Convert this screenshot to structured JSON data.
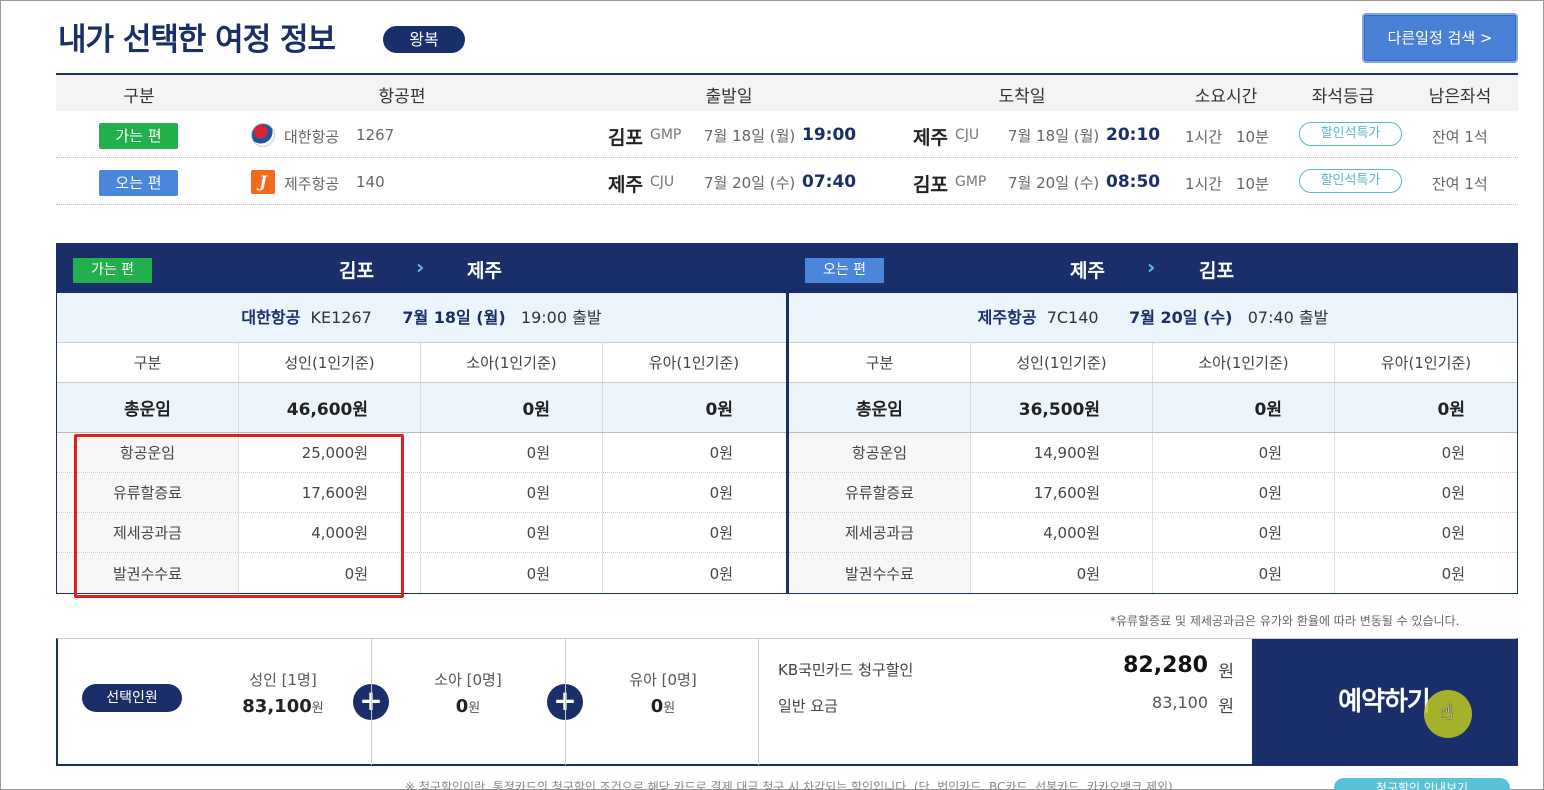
{
  "header": {
    "title": "내가 선택한 여정 정보",
    "trip_type": "왕복",
    "other_search": "다른일정 검색 >"
  },
  "summary": {
    "columns": [
      "구분",
      "항공편",
      "출발일",
      "도착일",
      "소요시간",
      "좌석등급",
      "남은좌석"
    ],
    "rows": [
      {
        "dir": "가는 편",
        "airline": "대한항공",
        "flight_no": "1267",
        "dep_city": "김포",
        "dep_code": "GMP",
        "dep_date": "7월 18일 (월)",
        "dep_time": "19:00",
        "arr_city": "제주",
        "arr_code": "CJU",
        "arr_date": "7월 18일 (월)",
        "arr_time": "20:10",
        "duration_h": "1시간",
        "duration_m": "10분",
        "seat_class": "할인석특가",
        "seats": "잔여 1석"
      },
      {
        "dir": "오는 편",
        "airline": "제주항공",
        "flight_no": "140",
        "dep_city": "제주",
        "dep_code": "CJU",
        "dep_date": "7월 20일 (수)",
        "dep_time": "07:40",
        "arr_city": "김포",
        "arr_code": "GMP",
        "arr_date": "7월 20일 (수)",
        "arr_time": "08:50",
        "duration_h": "1시간",
        "duration_m": "10분",
        "seat_class": "할인석특가",
        "seats": "잔여 1석"
      }
    ]
  },
  "panels": [
    {
      "badge": "가는 편",
      "from": "김포",
      "to": "제주",
      "airline": "대한항공",
      "flight_code": "KE1267",
      "date": "7월 18일 (월)",
      "depart": "19:00 출발",
      "headers": [
        "구분",
        "성인(1인기준)",
        "소아(1인기준)",
        "유아(1인기준)"
      ],
      "total": [
        "총운임",
        "46,600원",
        "0원",
        "0원"
      ],
      "rows": [
        [
          "항공운임",
          "25,000원",
          "0원",
          "0원"
        ],
        [
          "유류할증료",
          "17,600원",
          "0원",
          "0원"
        ],
        [
          "제세공과금",
          "4,000원",
          "0원",
          "0원"
        ],
        [
          "발권수수료",
          "0원",
          "0원",
          "0원"
        ]
      ]
    },
    {
      "badge": "오는 편",
      "from": "제주",
      "to": "김포",
      "airline": "제주항공",
      "flight_code": "7C140",
      "date": "7월 20일 (수)",
      "depart": "07:40 출발",
      "headers": [
        "구분",
        "성인(1인기준)",
        "소아(1인기준)",
        "유아(1인기준)"
      ],
      "total": [
        "총운임",
        "36,500원",
        "0원",
        "0원"
      ],
      "rows": [
        [
          "항공운임",
          "14,900원",
          "0원",
          "0원"
        ],
        [
          "유류할증료",
          "17,600원",
          "0원",
          "0원"
        ],
        [
          "제세공과금",
          "4,000원",
          "0원",
          "0원"
        ],
        [
          "발권수수료",
          "0원",
          "0원",
          "0원"
        ]
      ]
    }
  ],
  "note": "*유류할증료 및 제세공과금은 유가와 환율에 따라 변동될 수 있습니다.",
  "bottom": {
    "pax_badge": "선택인원",
    "adult_label": "성인 [1명]",
    "adult_amount": "83,100",
    "child_label": "소아 [0명]",
    "child_amount": "0",
    "infant_label": "유아 [0명]",
    "infant_amount": "0",
    "won": "원",
    "plus": "+",
    "kb_label": "KB국민카드 청구할인",
    "kb_price": "82,280",
    "normal_label": "일반 요금",
    "normal_price": "83,100",
    "reserve": "예약하기"
  },
  "footer": {
    "text": "※ 청구할인이란, 통정카드의 청구할인 조건으로 해당 카드로 결제 대금 청구 시 차감되는 할인입니다. (단, 법인카드, BC카드, 선불카드, 카카오뱅크 제외)",
    "button": "청구할인 안내보기"
  },
  "colors": {
    "navy": "#1a2f6a",
    "go_green": "#21b04b",
    "back_blue": "#4a86dc",
    "highlight_red": "#e02020",
    "accent_cyan": "#56c3e0"
  }
}
